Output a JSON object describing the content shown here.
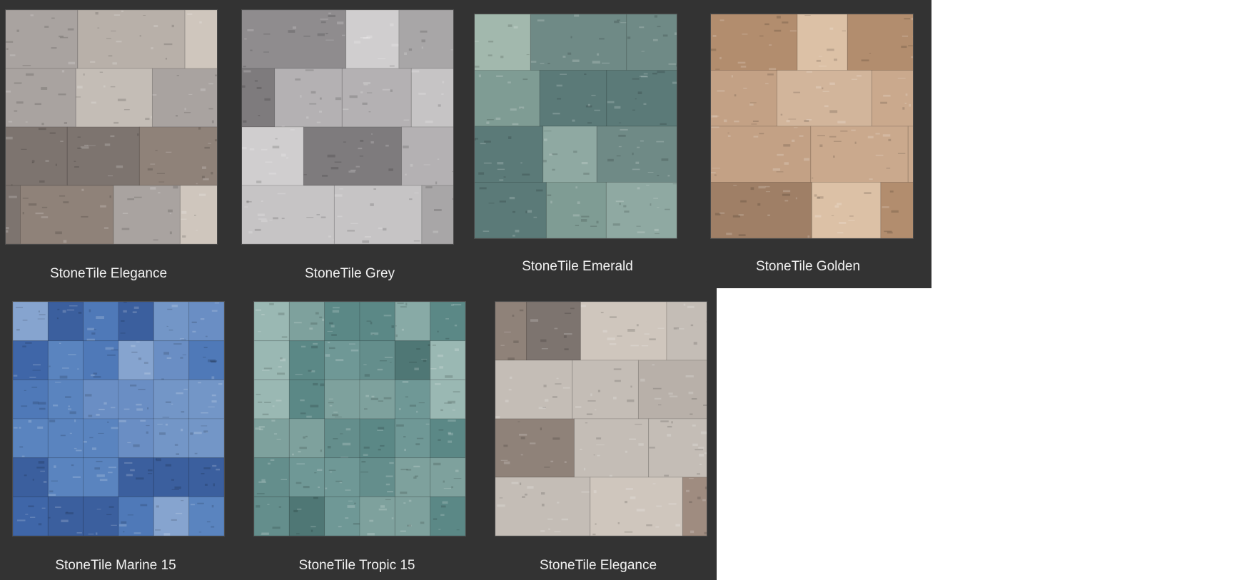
{
  "products": [
    {
      "name": "StoneTile Elegance",
      "colors": [
        "#a9a3a0",
        "#8f8279",
        "#c4bdb6",
        "#9f8c80",
        "#b8b0a9",
        "#7d746f",
        "#cfc6bd"
      ],
      "pattern": "plank"
    },
    {
      "name": "StoneTile Grey",
      "colors": [
        "#a8a6a7",
        "#7e7b7d",
        "#c6c4c5",
        "#8f8c8e",
        "#b4b1b3",
        "#6f6c6e",
        "#d0cecf"
      ],
      "pattern": "plank"
    },
    {
      "name": "StoneTile Emerald",
      "colors": [
        "#6f8a86",
        "#5b7a78",
        "#8fa9a2",
        "#7f9c94",
        "#4f6a6b",
        "#a2b8ad",
        "#657f84"
      ],
      "pattern": "plank"
    },
    {
      "name": "StoneTile Golden",
      "colors": [
        "#c3a185",
        "#b28d6e",
        "#d2b59b",
        "#a9876c",
        "#caa98d",
        "#9f7f66",
        "#dcc1a6"
      ],
      "pattern": "plank"
    },
    {
      "name": "StoneTile Marine 15",
      "colors": [
        "#4f79b8",
        "#3f66a8",
        "#6a8ec4",
        "#5a84bf",
        "#86a4cf",
        "#3b5f9e",
        "#7396c7"
      ],
      "pattern": "grid"
    },
    {
      "name": "StoneTile Tropic 15",
      "colors": [
        "#6f9896",
        "#5b8886",
        "#88aaa6",
        "#4f7775",
        "#9ab8b3",
        "#648e8c",
        "#7ea19d"
      ],
      "pattern": "grid"
    },
    {
      "name": "StoneTile Elegance",
      "colors": [
        "#a9a3a0",
        "#8f8279",
        "#c4bdb6",
        "#9f8c80",
        "#b8b0a9",
        "#7d746f",
        "#cfc6bd"
      ],
      "pattern": "plank"
    }
  ]
}
